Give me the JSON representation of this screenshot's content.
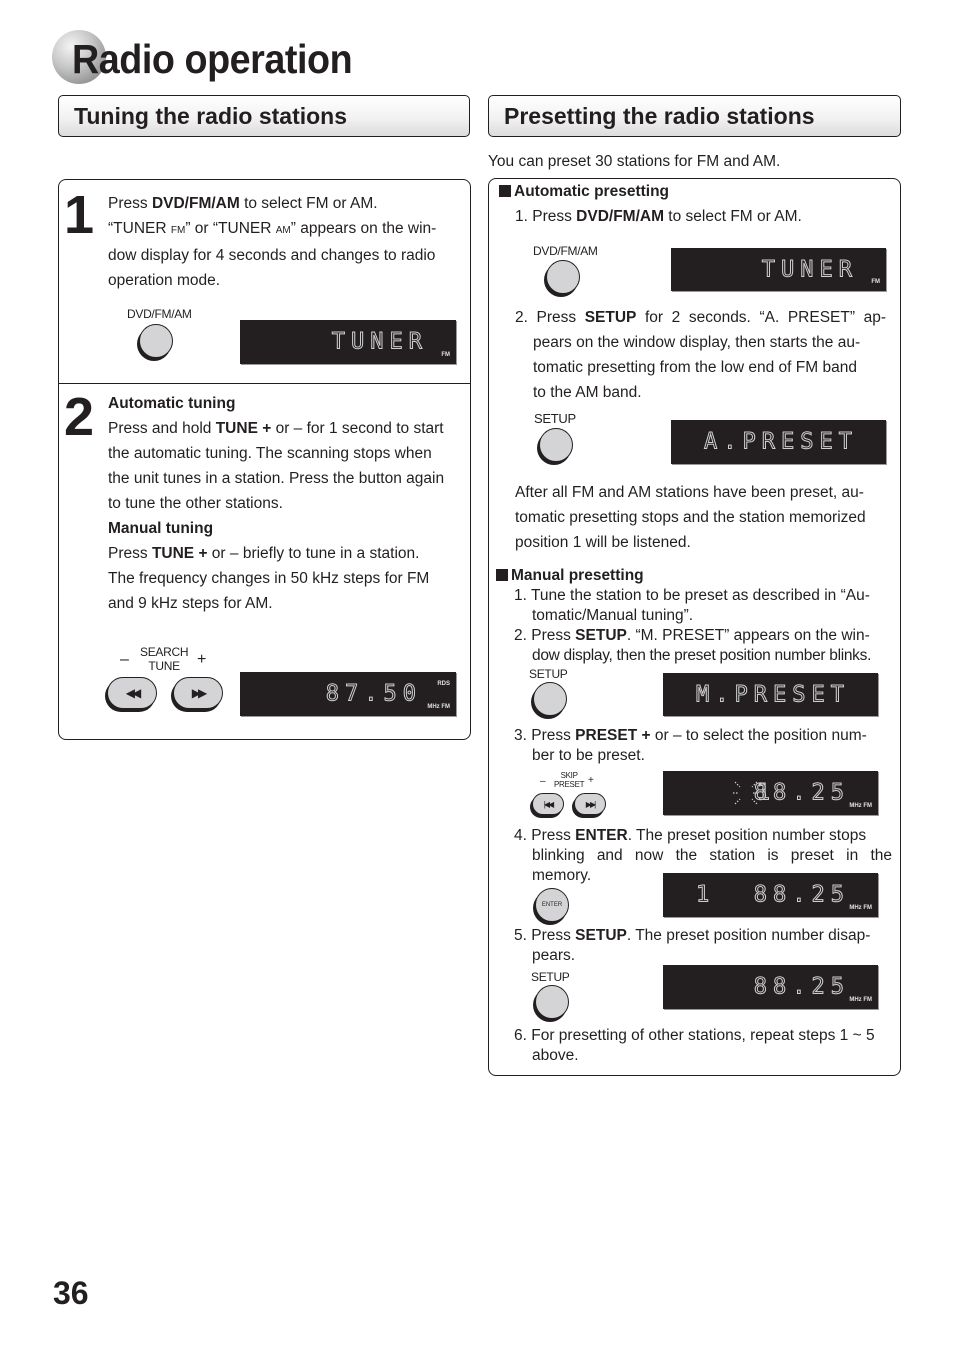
{
  "page": {
    "title": "Radio operation",
    "title_first_letter": "R",
    "title_rest": "adio operation",
    "page_number": "36"
  },
  "left": {
    "header": "Tuning the radio stations",
    "step1": {
      "number": "1",
      "line1_pre": "Press ",
      "line1_bold": "DVD/FM/AM",
      "line1_post": " to select FM or AM.",
      "line2_a": "“TUNER ",
      "line2_fm": "FM",
      "line2_b": "” or “TUNER ",
      "line2_am": "AM",
      "line2_c": "” appears on the win-",
      "line3": "dow display for 4 seconds and changes to radio",
      "line4": "operation mode.",
      "button_label": "DVD/FM/AM",
      "display": {
        "text": "TUNER",
        "indicator": "FM"
      }
    },
    "step2": {
      "number": "2",
      "auto_heading": "Automatic tuning",
      "auto_l1_pre": "Press and hold ",
      "auto_l1_bold": "TUNE +",
      "auto_l1_post": " or – for 1 second to start",
      "auto_l2": "the automatic tuning. The scanning stops when",
      "auto_l3": "the unit tunes in a station. Press the button again",
      "auto_l4": "to tune the other stations.",
      "manual_heading": "Manual tuning",
      "man_l1_pre": "Press ",
      "man_l1_bold": "TUNE +",
      "man_l1_post": " or – briefly to tune in a station.",
      "man_l2": "The frequency changes in 50 kHz steps for FM",
      "man_l3": "and 9 kHz steps for AM.",
      "search_label": "SEARCH",
      "tune_label": "TUNE",
      "minus": "–",
      "plus": "+",
      "rew_glyph": "◀◀",
      "ff_glyph": "▶▶",
      "display": {
        "text": "87.50",
        "indicator_top": "RDS",
        "indicator_bottom": "MHz FM"
      }
    }
  },
  "right": {
    "header": "Presetting the radio stations",
    "intro": "You can preset 30 stations for FM and AM.",
    "auto": {
      "heading": "Automatic presetting",
      "s1_pre": "1. Press ",
      "s1_bold": "DVD/FM/AM",
      "s1_post": " to select FM or AM.",
      "s1_button": "DVD/FM/AM",
      "s1_display": {
        "text": "TUNER",
        "indicator": "FM"
      },
      "s2_pre": "2. Press ",
      "s2_bold": "SETUP",
      "s2_post": " for 2 seconds. “A. PRESET” ap-",
      "s2_l2": "pears on the window display, then starts the au-",
      "s2_l3": "tomatic presetting from the low end of FM band",
      "s2_l4": "to the AM band.",
      "s2_button": "SETUP",
      "s2_display": {
        "text": "A.PRESET"
      },
      "after_l1": "After all FM and AM stations have been preset, au-",
      "after_l2": "tomatic presetting stops and the station memorized",
      "after_l3": "position 1 will be listened."
    },
    "manual": {
      "heading": "Manual presetting",
      "s1_l1": "1. Tune the station to be preset as described in “Au-",
      "s1_l2": "tomatic/Manual tuning”.",
      "s2_pre": "2. Press ",
      "s2_bold": "SETUP",
      "s2_post": ". “M. PRESET” appears on the win-",
      "s2_l2": "dow display, then the preset position number blinks.",
      "s2_button": "SETUP",
      "s2_display": {
        "text": "M.PRESET"
      },
      "s3_pre": "3. Press ",
      "s3_bold": "PRESET +",
      "s3_post": " or –  to select the position num-",
      "s3_l2": "ber to be preset.",
      "s3_skip": "SKIP",
      "s3_preset": "PRESET",
      "s3_minus": "–",
      "s3_plus": "+",
      "s3_prev_glyph": "|◀◀",
      "s3_next_glyph": "▶▶|",
      "s3_display": {
        "position": "1",
        "freq": "88.25",
        "indicator": "MHz FM",
        "blinking": true
      },
      "s4_pre": "4. Press ",
      "s4_bold": "ENTER",
      "s4_post": ". The preset position number stops",
      "s4_l2": "blinking and now the station is preset in the",
      "s4_l3": "memory.",
      "s4_button": "ENTER",
      "s4_display": {
        "text": "1  88.25",
        "indicator": "MHz FM"
      },
      "s5_pre": "5. Press ",
      "s5_bold": "SETUP",
      "s5_post": ". The preset position number disap-",
      "s5_l2": "pears.",
      "s5_button": "SETUP",
      "s5_display": {
        "text": "88.25",
        "indicator": "MHz FM"
      },
      "s6_l1": "6. For presetting of other stations, repeat steps 1 ~ 5",
      "s6_l2": "above."
    }
  }
}
